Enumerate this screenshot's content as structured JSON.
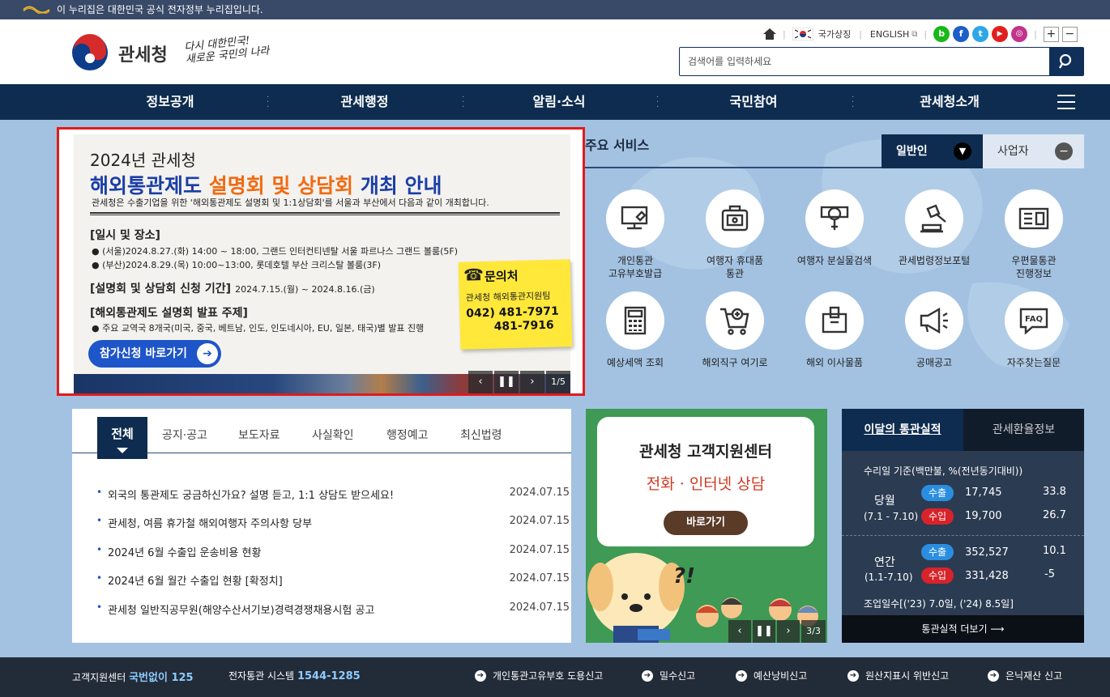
{
  "gov_banner": {
    "text": "이 누리집은 대한민국 공식 전자정부 누리집입니다."
  },
  "header": {
    "logo_name": "관세청",
    "slogan_line1": "다시 대한민국!",
    "slogan_line2": "새로운 국민의 나라",
    "util": {
      "national_symbol": "국가상징",
      "english": "ENGLISH"
    },
    "search": {
      "placeholder": "검색어를 입력하세요"
    }
  },
  "gnb": [
    "정보공개",
    "관세행정",
    "알림·소식",
    "국민참여",
    "관세청소개"
  ],
  "banner": {
    "title_line1": "2024년 관세청",
    "title_part1": "해외통관제도 ",
    "title_part2": "설명회 및 상담회",
    "title_part3": " 개최 안내",
    "desc": "관세청은 수출기업을 위한 '해외통관제도 설명회 및 1:1상담회'를 서울과 부산에서 다음과 같이 개최합니다.",
    "sec1_title": "[일시 및 장소]",
    "sec1_line1": "● (서울)2024.8.27.(화) 14:00 ~ 18:00, 그랜드 인터컨티넨탈 서울 파르나스 그랜드 볼룸(5F)",
    "sec1_line2": "● (부산)2024.8.29.(목) 10:00~13:00, 롯데호텔 부산 크리스탈 볼룸(3F)",
    "sec2_title": "[설명회 및 상담회 신청 기간]",
    "sec2_period": "2024.7.15.(월) ~ 2024.8.16.(금)",
    "sec3_title": "[해외통관제도 설명회 발표 주제]",
    "sec3_line1": "● 주요 교역국 8개국(미국, 중국, 베트남, 인도, 인도네시아, EU, 일본, 태국)별 발표 진행",
    "contact_title": "문의처",
    "contact_team": "관세청 해외통관지원팀",
    "contact_phone1": "042) 481-7971",
    "contact_phone2": "481-7916",
    "join_button": "참가신청 바로가기",
    "pager": "1/5"
  },
  "services": {
    "title": "주요 서비스",
    "tab_general": "일반인",
    "tab_business": "사업자",
    "items": [
      {
        "label1": "개인통관",
        "label2": "고유부호발급",
        "icon": "monitor-icon"
      },
      {
        "label1": "여행자 휴대품",
        "label2": "통관",
        "icon": "suitcase-icon"
      },
      {
        "label1": "여행자 분실물검색",
        "label2": "",
        "icon": "magnifier-icon"
      },
      {
        "label1": "관세법령정보포털",
        "label2": "",
        "icon": "gavel-icon"
      },
      {
        "label1": "우편물통관",
        "label2": "진행정보",
        "icon": "mail-icon"
      },
      {
        "label1": "예상세액 조회",
        "label2": "",
        "icon": "calculator-icon"
      },
      {
        "label1": "해외직구 여기로",
        "label2": "",
        "icon": "cart-icon"
      },
      {
        "label1": "해외 이사물품",
        "label2": "",
        "icon": "box-icon"
      },
      {
        "label1": "공매공고",
        "label2": "",
        "icon": "megaphone-icon"
      },
      {
        "label1": "자주찾는질문",
        "label2": "",
        "icon": "faq-icon"
      }
    ]
  },
  "news": {
    "tabs": [
      "전체",
      "공지·공고",
      "보도자료",
      "사실확인",
      "행정예고",
      "최신법령"
    ],
    "rows": [
      {
        "title": "외국의 통관제도 궁금하신가요? 설명 듣고, 1:1 상담도 받으세요!",
        "date": "2024.07.15"
      },
      {
        "title": "관세청, 여름 휴가철 해외여행자 주의사항 당부",
        "date": "2024.07.15"
      },
      {
        "title": "2024년 6월 수출입 운송비용 현황",
        "date": "2024.07.15"
      },
      {
        "title": "2024년 6월 월간 수출입 현황 [확정치]",
        "date": "2024.07.15"
      },
      {
        "title": "관세청 일반직공무원(해양수산서기보)경력경쟁채용시험 공고",
        "date": "2024.07.15"
      }
    ]
  },
  "cs_center": {
    "title": "관세청 고객지원센터",
    "subtitle": "전화 · 인터넷 상담",
    "button": "바로가기",
    "exclaim": "?!",
    "pager": "3/3"
  },
  "stats": {
    "tab_active": "이달의 통관실적",
    "tab_other": "관세환율정보",
    "basis": "수리일 기준(백만불, %(전년동기대비))",
    "month_label": "당월",
    "month_range": "(7.1 - 7.10)",
    "year_label": "연간",
    "year_range": "(1.1-7.10)",
    "export_label": "수출",
    "import_label": "수입",
    "month_export": "17,745",
    "month_export_pct": "33.8",
    "month_import": "19,700",
    "month_import_pct": "26.7",
    "year_export": "352,527",
    "year_export_pct": "10.1",
    "year_import": "331,428",
    "year_import_pct": "-5",
    "workdays": "조업일수[('23) 7.0일, ('24) 8.5일]",
    "more": "통관실적 더보기"
  },
  "footer": {
    "cs_label": "고객지원센터",
    "cs_num": "국번없이 125",
    "edi_label": "전자통관 시스템",
    "edi_num": "1544-1285",
    "links": [
      "개인통관고유부호 도용신고",
      "밀수신고",
      "예산낭비신고",
      "원산지표시 위반신고",
      "은닉재산 신고"
    ]
  },
  "colors": {
    "navy": "#0e2c4f",
    "accent_orange": "#f06a12",
    "banner_border": "#e11b1b",
    "export": "#2a8ee0",
    "import": "#d8232a"
  }
}
